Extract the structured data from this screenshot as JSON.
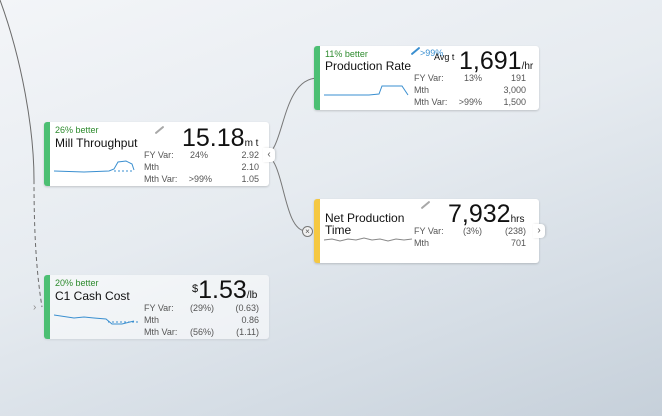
{
  "cards": {
    "mill": {
      "status": "26% better",
      "title": "Mill Throughput",
      "value": "15.18",
      "unit": "m t",
      "rows": [
        {
          "label": "FY Var:",
          "pct": "24%",
          "val": "2.92"
        },
        {
          "label": "Mth",
          "pct": "",
          "val": "2.10"
        },
        {
          "label": "Mth Var:",
          "pct": ">99%",
          "val": "1.05"
        }
      ]
    },
    "production_rate": {
      "status": "11% better",
      "extra": ">99%",
      "avg_label": "Avg t",
      "title": "Production Rate",
      "value": "1,691",
      "unit": "/hr",
      "rows": [
        {
          "label": "FY Var:",
          "pct": "13%",
          "val": "191"
        },
        {
          "label": "Mth",
          "pct": "",
          "val": "3,000"
        },
        {
          "label": "Mth Var:",
          "pct": ">99%",
          "val": "1,500"
        }
      ]
    },
    "net_production": {
      "title_line1": "Net Production",
      "title_line2": "Time",
      "value": "7,932",
      "unit": "hrs",
      "rows": [
        {
          "label": "FY Var:",
          "pct": "(3%)",
          "val": "(238)"
        },
        {
          "label": "Mth",
          "pct": "",
          "val": "701"
        }
      ]
    },
    "c1_cash": {
      "status": "20% better",
      "title": "C1 Cash Cost",
      "currency": "$",
      "value": "1.53",
      "unit": "/lb",
      "rows": [
        {
          "label": "FY Var:",
          "pct": "(29%)",
          "val": "(0.63)"
        },
        {
          "label": "Mth",
          "pct": "",
          "val": "0.86"
        },
        {
          "label": "Mth Var:",
          "pct": "(56%)",
          "val": "(1.11)"
        }
      ]
    }
  },
  "icons": {
    "expand": "chevron-left-icon",
    "collapse": "chevron-right-icon",
    "multiply": "multiply-icon",
    "edit": "pencil-icon"
  },
  "colors": {
    "good": "#4cbf73",
    "warning": "#f5c842",
    "spark": "#3a8fd0"
  }
}
